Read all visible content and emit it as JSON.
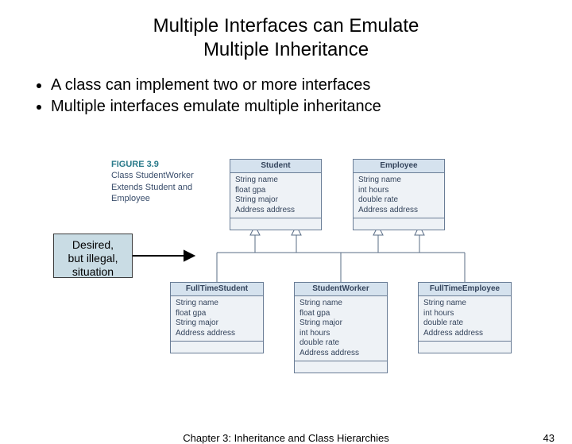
{
  "title_line1": "Multiple Interfaces can Emulate",
  "title_line2": "Multiple Inheritance",
  "bullets": {
    "b1": "A class can implement two or more interfaces",
    "b2": "Multiple interfaces emulate multiple inheritance"
  },
  "figure": {
    "label": "FIGURE 3.9",
    "caption_l1": "Class StudentWorker",
    "caption_l2": "Extends Student and",
    "caption_l3": "Employee"
  },
  "callout": {
    "l1": "Desired,",
    "l2": "but illegal,",
    "l3": "situation"
  },
  "uml": {
    "student": {
      "name": "Student",
      "attrs": "String name\nfloat gpa\nString major\nAddress address"
    },
    "employee": {
      "name": "Employee",
      "attrs": "String name\nint hours\ndouble rate\nAddress address"
    },
    "fts": {
      "name": "FullTimeStudent",
      "attrs": "String name\nfloat gpa\nString major\nAddress address"
    },
    "sw": {
      "name": "StudentWorker",
      "attrs": "String name\nfloat gpa\nString major\nint hours\ndouble rate\nAddress address"
    },
    "fte": {
      "name": "FullTimeEmployee",
      "attrs": "String name\nint hours\ndouble rate\nAddress address"
    }
  },
  "footer": {
    "chapter": "Chapter 3: Inheritance and Class Hierarchies",
    "page": "43"
  }
}
